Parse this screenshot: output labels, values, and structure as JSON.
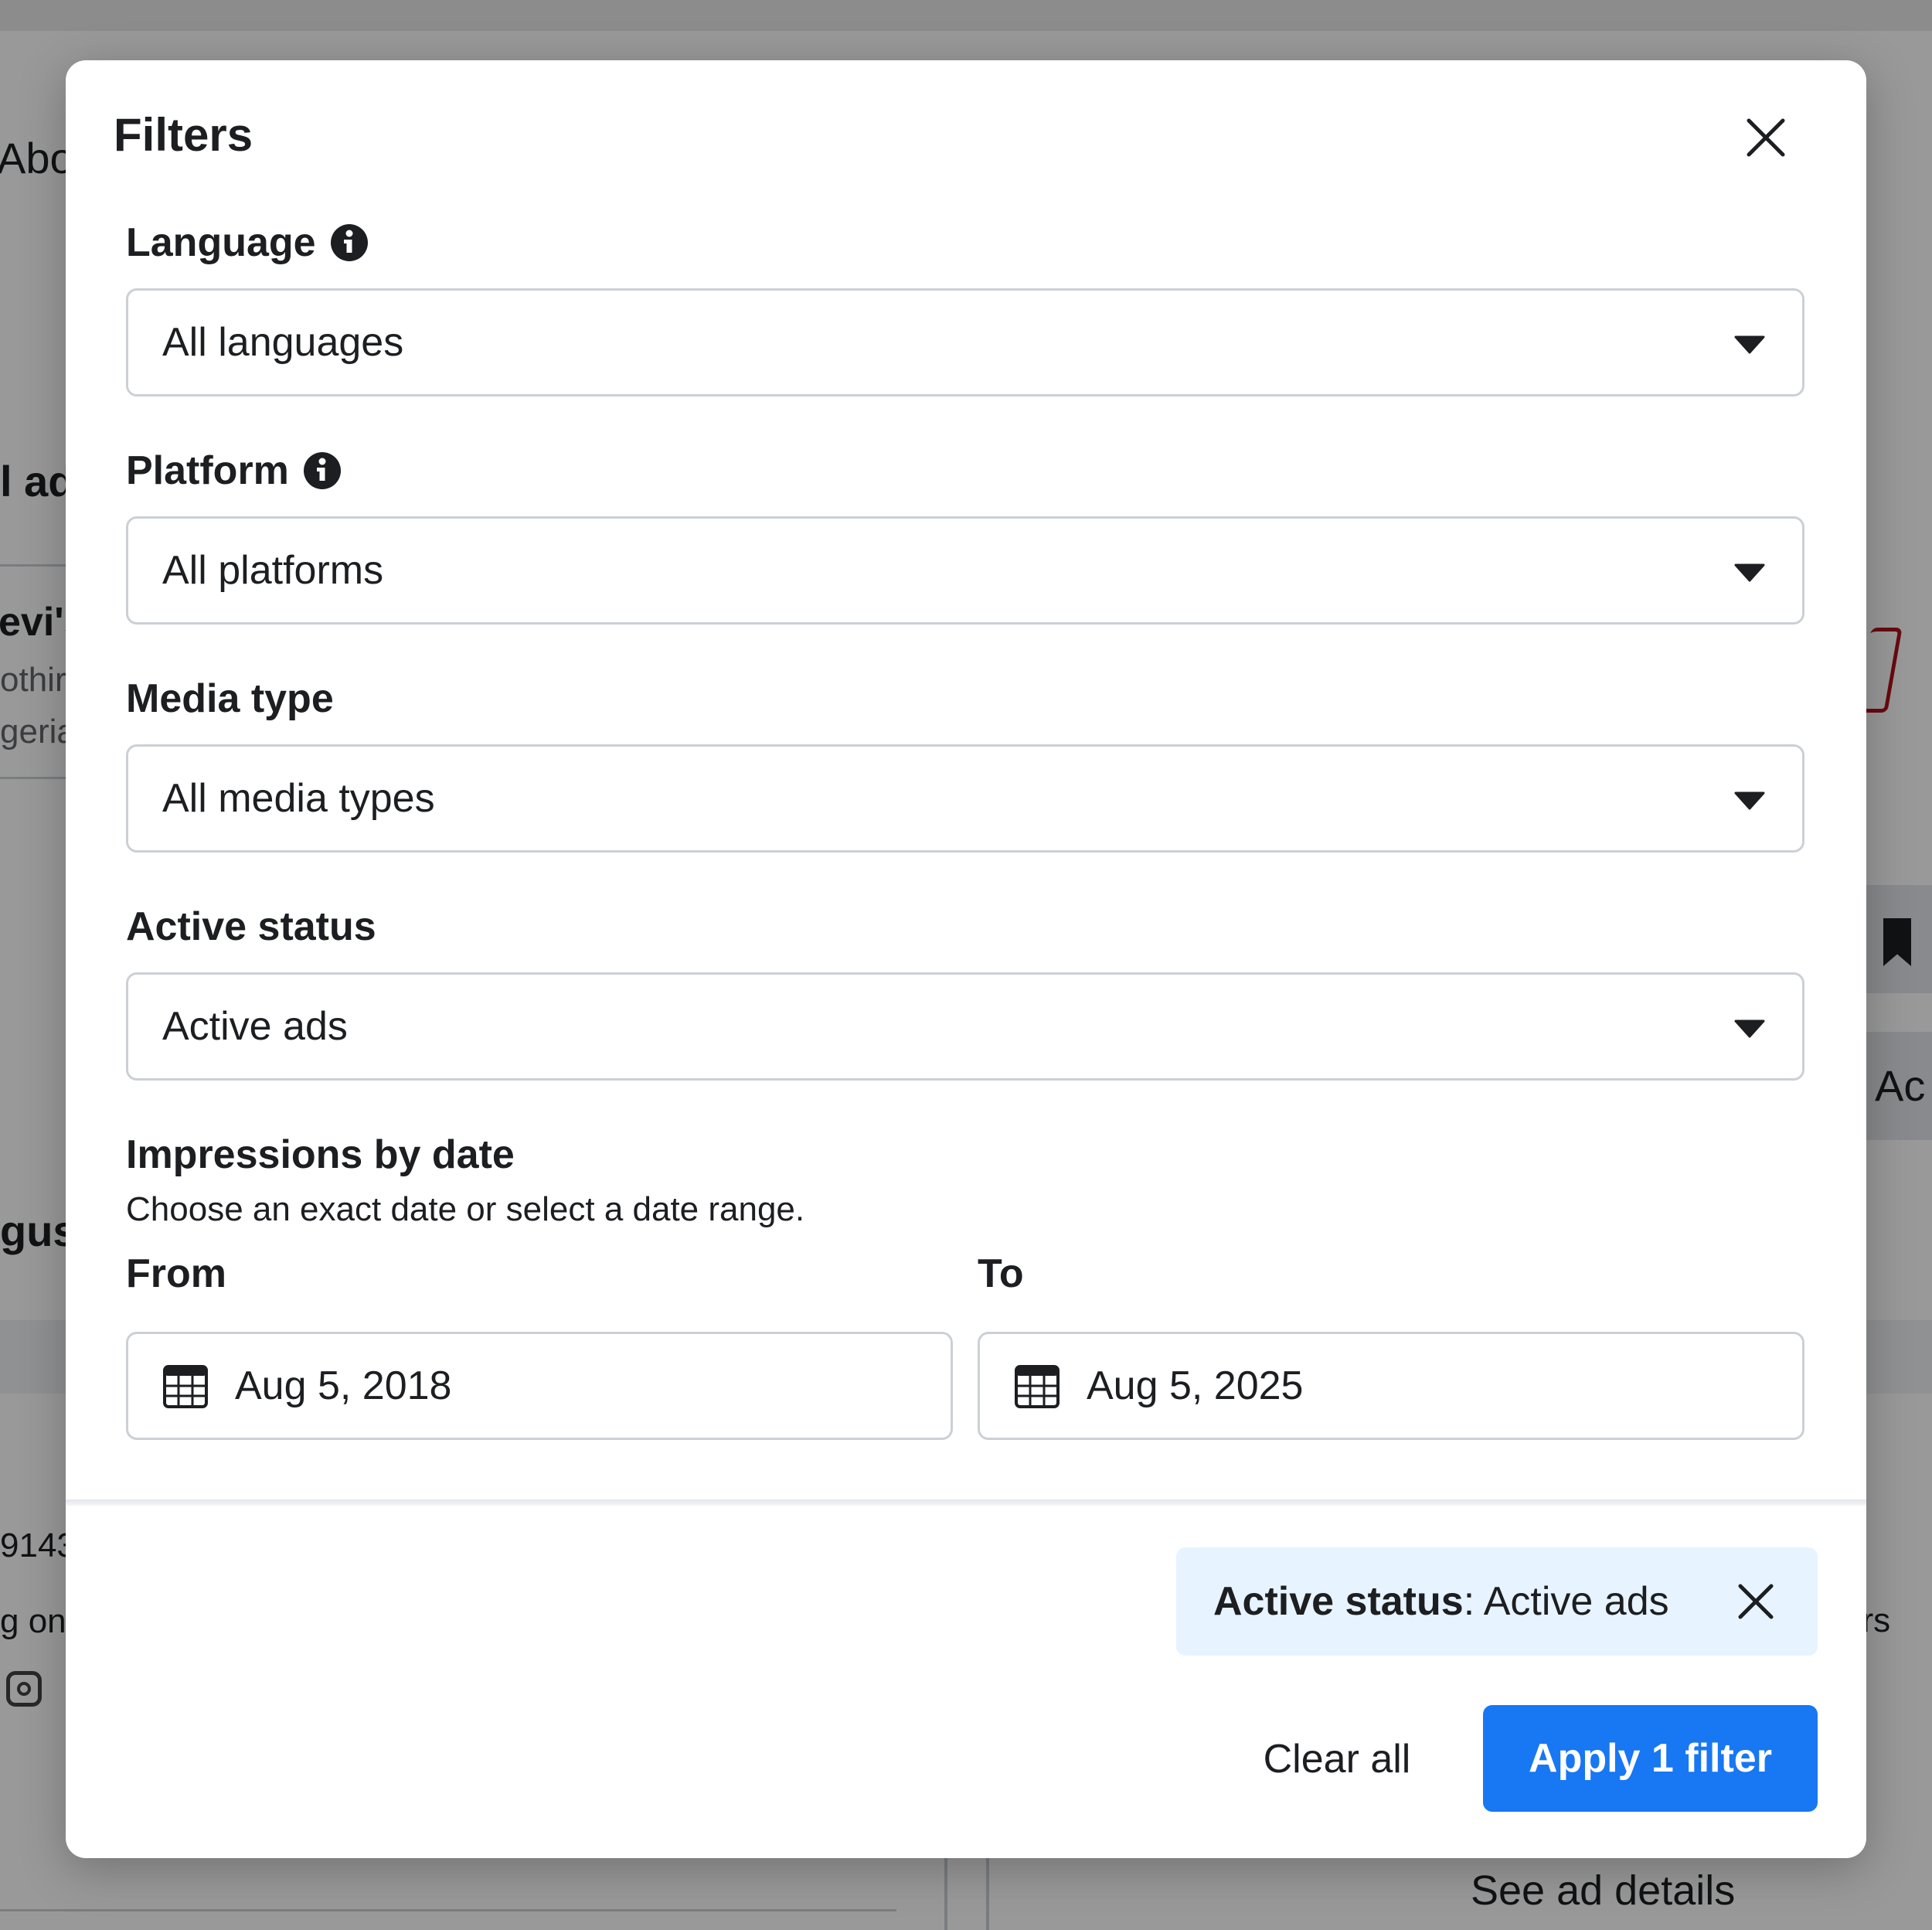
{
  "background": {
    "fragments": [
      {
        "id": "about",
        "text": "Abo"
      },
      {
        "id": "all-ads",
        "text": "l ad"
      },
      {
        "id": "levis",
        "text": "evi's"
      },
      {
        "id": "clothing",
        "text": "othir"
      },
      {
        "id": "nigeria",
        "text": "geria"
      },
      {
        "id": "august",
        "text": "gus"
      },
      {
        "id": "id-number",
        "text": "9143"
      },
      {
        "id": "running-on",
        "text": "g on"
      },
      {
        "id": "active",
        "text": ": Ac"
      },
      {
        "id": "hrs",
        "text": "hrs"
      },
      {
        "id": "see-ad-details",
        "text": "See ad details"
      }
    ]
  },
  "modal": {
    "title": "Filters",
    "language": {
      "label": "Language",
      "value": "All languages"
    },
    "platform": {
      "label": "Platform",
      "value": "All platforms"
    },
    "media_type": {
      "label": "Media type",
      "value": "All media types"
    },
    "active_status": {
      "label": "Active status",
      "value": "Active ads"
    },
    "impressions": {
      "label": "Impressions by date",
      "helper": "Choose an exact date or select a date range.",
      "from_label": "From",
      "from_value": "Aug 5, 2018",
      "to_label": "To",
      "to_value": "Aug 5, 2025"
    },
    "chip": {
      "key": "Active status",
      "separator": ": ",
      "value": "Active ads"
    },
    "clear_all": "Clear all",
    "apply": "Apply 1 filter"
  },
  "colors": {
    "accent": "#1877f2",
    "chip_bg": "#e7f3ff",
    "border": "#ccd0d5"
  }
}
